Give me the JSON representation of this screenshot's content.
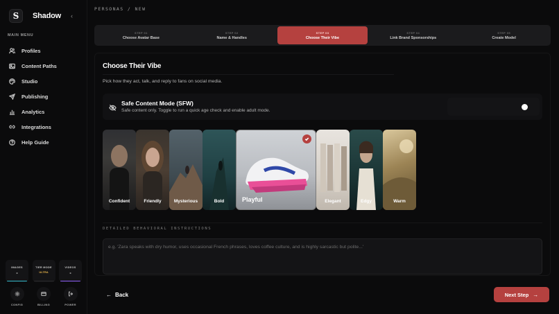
{
  "app": {
    "brand_name": "Shadow",
    "logo_glyph": "S"
  },
  "sidebar": {
    "menu_label": "MAIN MENU",
    "items": [
      {
        "label": "Profiles",
        "icon": "users-icon"
      },
      {
        "label": "Content Paths",
        "icon": "image-icon"
      },
      {
        "label": "Studio",
        "icon": "palette-icon"
      },
      {
        "label": "Publishing",
        "icon": "send-icon"
      },
      {
        "label": "Analytics",
        "icon": "bar-chart-icon"
      },
      {
        "label": "Integrations",
        "icon": "link-icon"
      },
      {
        "label": "Help Guide",
        "icon": "help-icon"
      }
    ],
    "credits": [
      {
        "title": "IMAGES",
        "value": "-",
        "color": "#2fb6c7"
      },
      {
        "title": "TIER MODE",
        "value": "ULTRA",
        "color": "#e3b14a"
      },
      {
        "title": "VIDEOS",
        "value": "-",
        "color": "#8b5cf6"
      }
    ],
    "footer": [
      {
        "label": "CONFIG",
        "icon": "gear-icon"
      },
      {
        "label": "BILLING",
        "icon": "card-icon"
      },
      {
        "label": "POWER",
        "icon": "logout-icon"
      }
    ]
  },
  "breadcrumb": "PERSONAS / NEW",
  "steps": [
    {
      "number": "STEP 01",
      "title": "Choose Avatar Base"
    },
    {
      "number": "STEP 02",
      "title": "Name & Handles"
    },
    {
      "number": "STEP 03",
      "title": "Choose Their Vibe"
    },
    {
      "number": "STEP 04",
      "title": "Link Brand Sponsorships"
    },
    {
      "number": "STEP 05",
      "title": "Create Model"
    }
  ],
  "panel": {
    "title": "Choose Their Vibe",
    "subtitle": "Pick how they act, talk, and reply to fans on social media."
  },
  "safe_mode": {
    "title": "Safe Content Mode (SFW)",
    "description": "Safe content only. Toggle to run a quick age check and enable adult mode."
  },
  "vibes": [
    {
      "label": "Confident"
    },
    {
      "label": "Friendly"
    },
    {
      "label": "Mysterious"
    },
    {
      "label": "Bold"
    },
    {
      "label": "Playful"
    },
    {
      "label": "Elegant"
    },
    {
      "label": "Edgy"
    },
    {
      "label": "Warm"
    }
  ],
  "instructions": {
    "label": "DETAILED BEHAVIORAL INSTRUCTIONS",
    "placeholder": "e.g. 'Zara speaks with dry humor, uses occasional French phrases, loves coffee culture, and is highly sarcastic but polite...'"
  },
  "buttons": {
    "back": "Back",
    "next": "Next Step"
  },
  "colors": {
    "accent": "#b5413f"
  }
}
